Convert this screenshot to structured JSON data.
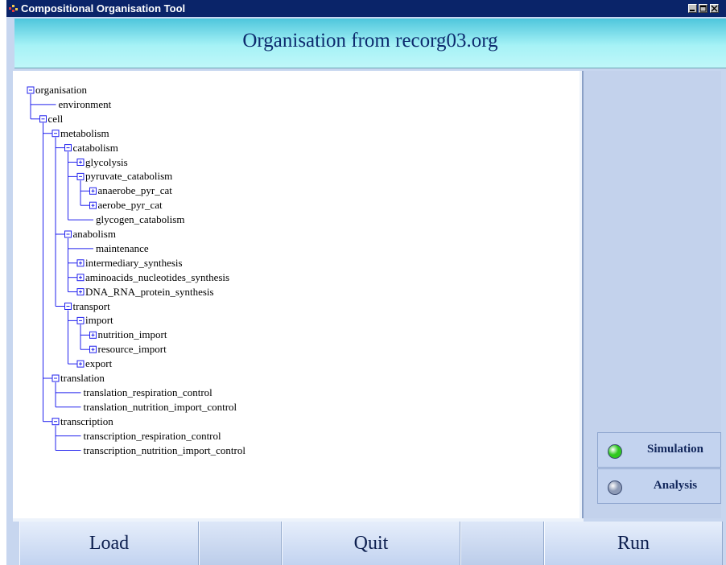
{
  "window": {
    "title": "Compositional Organisation Tool"
  },
  "header": {
    "title": "Organisation from recorg03.org"
  },
  "tree": [
    {
      "label": "organisation",
      "toggle": "minus"
    },
    {
      "label": "environment",
      "toggle": "none"
    },
    {
      "label": "cell",
      "toggle": "minus"
    },
    {
      "label": "metabolism",
      "toggle": "minus"
    },
    {
      "label": "catabolism",
      "toggle": "minus"
    },
    {
      "label": "glycolysis",
      "toggle": "plus"
    },
    {
      "label": "pyruvate_catabolism",
      "toggle": "minus"
    },
    {
      "label": "anaerobe_pyr_cat",
      "toggle": "plus"
    },
    {
      "label": "aerobe_pyr_cat",
      "toggle": "plus"
    },
    {
      "label": "glycogen_catabolism",
      "toggle": "none"
    },
    {
      "label": "anabolism",
      "toggle": "minus"
    },
    {
      "label": "maintenance",
      "toggle": "none"
    },
    {
      "label": "intermediary_synthesis",
      "toggle": "plus"
    },
    {
      "label": "aminoacids_nucleotides_synthesis",
      "toggle": "plus"
    },
    {
      "label": "DNA_RNA_protein_synthesis",
      "toggle": "plus"
    },
    {
      "label": "transport",
      "toggle": "minus"
    },
    {
      "label": "import",
      "toggle": "minus"
    },
    {
      "label": "nutrition_import",
      "toggle": "plus"
    },
    {
      "label": "resource_import",
      "toggle": "plus"
    },
    {
      "label": "export",
      "toggle": "plus"
    },
    {
      "label": "translation",
      "toggle": "minus"
    },
    {
      "label": "translation_respiration_control",
      "toggle": "none"
    },
    {
      "label": "translation_nutrition_import_control",
      "toggle": "none"
    },
    {
      "label": "transcription",
      "toggle": "minus"
    },
    {
      "label": "transcription_respiration_control",
      "toggle": "none"
    },
    {
      "label": "transcription_nutrition_import_control",
      "toggle": "none"
    }
  ],
  "side_buttons": {
    "simulation": {
      "label": "Simulation",
      "status_color": "#2fc81f"
    },
    "analysis": {
      "label": "Analysis",
      "status_color": "#8d9ab6"
    }
  },
  "bottom_buttons": {
    "load": "Load",
    "quit": "Quit",
    "run": "Run"
  }
}
